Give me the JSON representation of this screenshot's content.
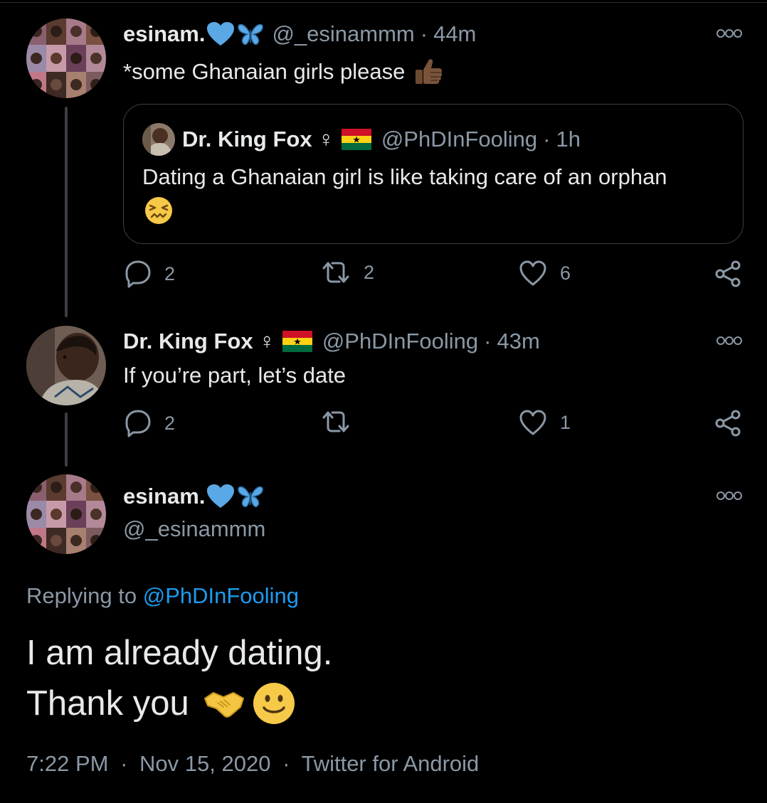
{
  "tweet1": {
    "display_name": "esinam.",
    "name_emojis": [
      "blue-heart-emoji",
      "butterfly-emoji"
    ],
    "handle": "@_esinammm",
    "time": "44m",
    "text": "*some Ghanaian girls please",
    "text_emoji": "thumbs-up-emoji",
    "quote": {
      "display_name": "Dr. King Fox",
      "name_symbols": [
        "female-sign",
        "ghana-flag-emoji"
      ],
      "handle": "@PhDInFooling",
      "time": "1h",
      "text": "Dating a Ghanaian girl is like taking care of an orphan",
      "text_emoji": "confounded-face-emoji"
    },
    "actions": {
      "replies": "2",
      "retweets": "2",
      "likes": "6"
    }
  },
  "tweet2": {
    "display_name": "Dr. King Fox",
    "name_symbols": [
      "female-sign",
      "ghana-flag-emoji"
    ],
    "handle": "@PhDInFooling",
    "time": "43m",
    "text": "If you’re part, let’s date",
    "actions": {
      "replies": "2",
      "retweets": "",
      "likes": "1"
    }
  },
  "main_tweet": {
    "display_name": "esinam.",
    "name_emojis": [
      "blue-heart-emoji",
      "butterfly-emoji"
    ],
    "handle": "@_esinammm",
    "replying_prefix": "Replying to",
    "replying_handle": "@PhDInFooling",
    "line1": "I am already dating.",
    "line2": "Thank you",
    "line2_emojis": [
      "handshake-emoji",
      "slightly-smiling-face-emoji"
    ],
    "timestamp": "7:22 PM",
    "date": "Nov 15, 2020",
    "client": "Twitter for Android"
  },
  "separators": {
    "dot": "·"
  },
  "colors": {
    "background": "#000000",
    "text": "#e7e9ea",
    "muted": "#8b98a5",
    "link": "#1d9bf0",
    "heart_emoji": "#5aa9e6",
    "border": "#3a3f44"
  }
}
